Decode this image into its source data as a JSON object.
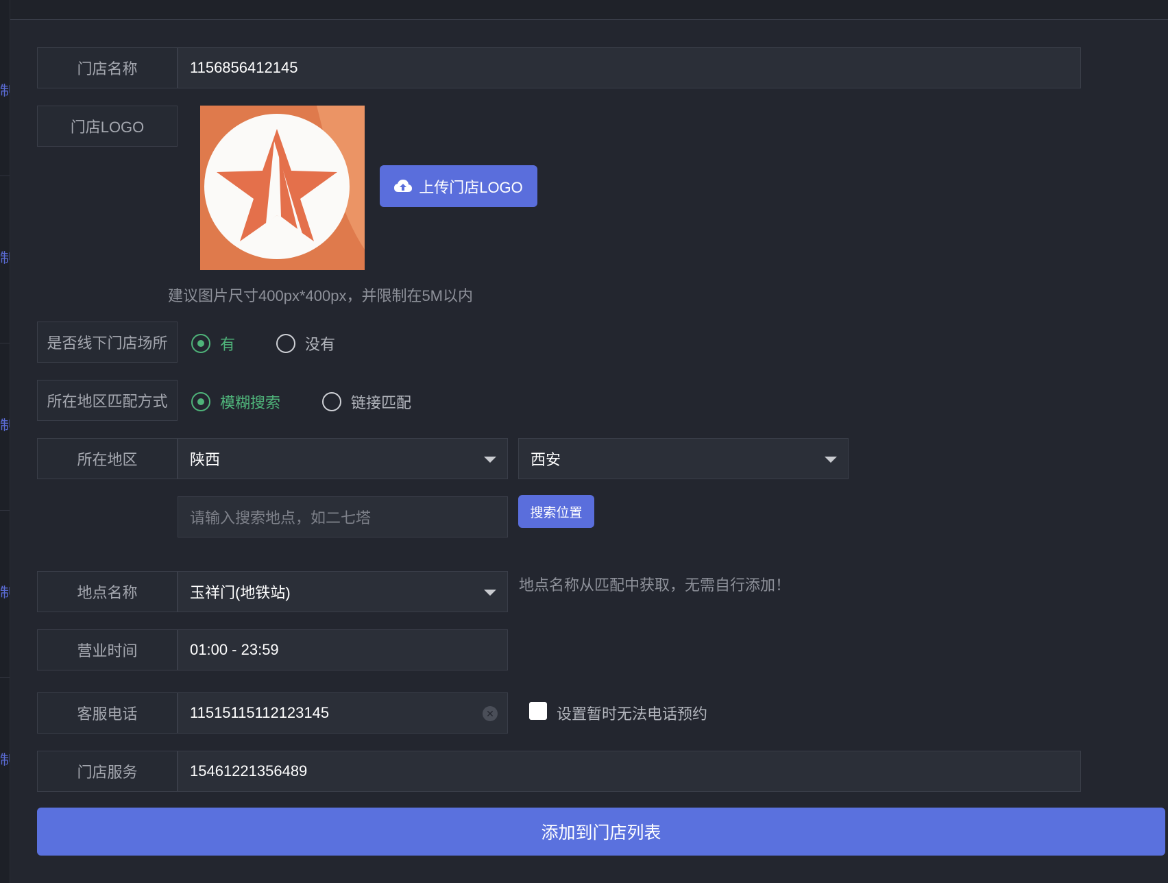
{
  "form": {
    "store_name": {
      "label": "门店名称",
      "value": "1156856412145"
    },
    "store_logo": {
      "label": "门店LOGO",
      "upload_label": "上传门店LOGO",
      "hint": "建议图片尺寸400px*400px，并限制在5M以内"
    },
    "offline_venue": {
      "label": "是否线下门店场所",
      "options": [
        "有",
        "没有"
      ],
      "selected": "有"
    },
    "region_match": {
      "label": "所在地区匹配方式",
      "options": [
        "模糊搜索",
        "链接匹配"
      ],
      "selected": "模糊搜索"
    },
    "region": {
      "label": "所在地区",
      "province": "陕西",
      "city": "西安"
    },
    "location_search": {
      "placeholder": "请输入搜索地点，如二七塔",
      "button_label": "搜索位置"
    },
    "place_name": {
      "label": "地点名称",
      "value": "玉祥门(地铁站)",
      "note": "地点名称从匹配中获取，无需自行添加！"
    },
    "business_hours": {
      "label": "营业时间",
      "value": "01:00 - 23:59"
    },
    "service_phone": {
      "label": "客服电话",
      "value": "11515115112123145",
      "checkbox_label": "设置暂时无法电话预约",
      "checked": false
    },
    "store_service": {
      "label": "门店服务",
      "value": "15461221356489"
    }
  },
  "submit_label": "添加到门店列表",
  "colors": {
    "accent": "#5a71de",
    "selected_radio": "#4fb47a",
    "background": "#23262f"
  }
}
